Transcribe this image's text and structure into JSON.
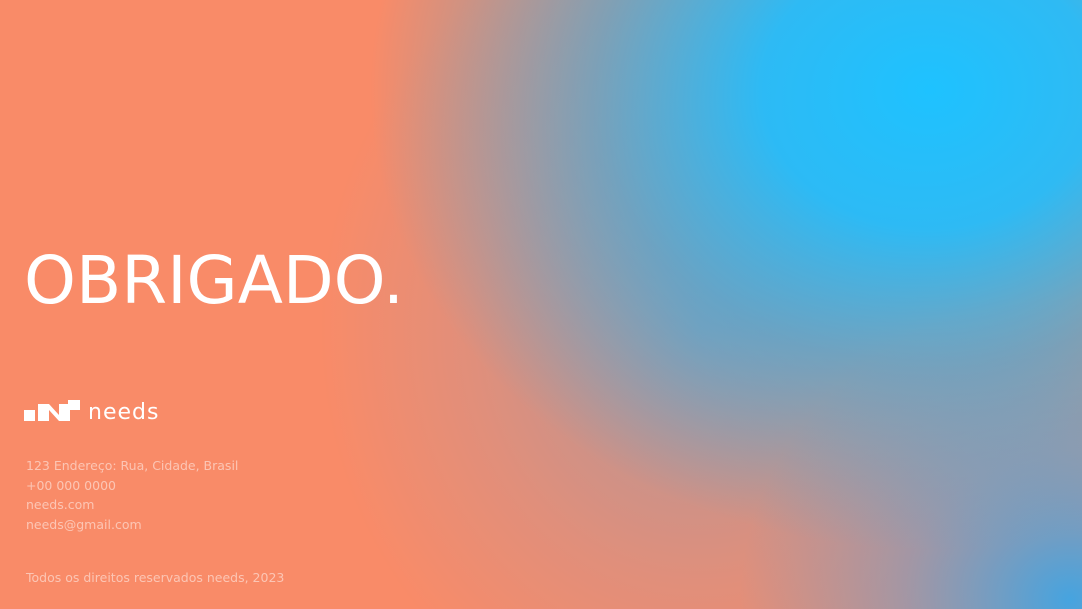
{
  "slide": {
    "title": "OBRIGADO.",
    "brand": {
      "name": "needs",
      "logo_icon": "needs-logo-mark"
    },
    "contact": {
      "address": "123 Endereço: Rua, Cidade, Brasil",
      "phone": "+00 000 0000",
      "website": "needs.com",
      "email": "needs@gmail.com"
    },
    "footer": "Todos os direitos reservados needs, 2023"
  },
  "colors": {
    "coral": "#f98b68",
    "sky_blue": "#1ec2ff",
    "text": "#ffffff"
  }
}
